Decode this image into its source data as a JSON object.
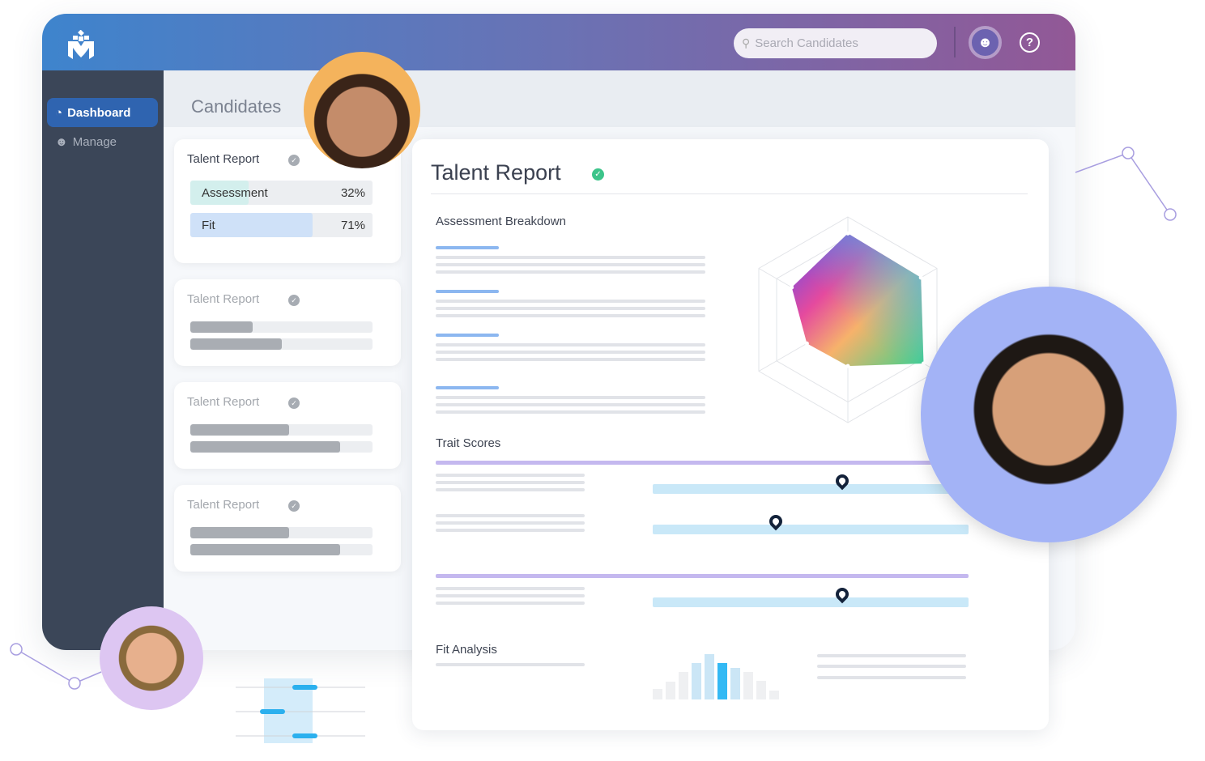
{
  "header": {
    "search_placeholder": "Search Candidates",
    "icons": [
      "logo-icon",
      "search-icon",
      "user-icon",
      "help-icon"
    ],
    "gradient": [
      "#3e84cd",
      "#925896"
    ]
  },
  "sidebar": {
    "items": [
      {
        "label": "Dashboard",
        "icon": "pie-chart-icon",
        "active": true
      },
      {
        "label": "Manage",
        "icon": "users-icon",
        "active": false
      }
    ]
  },
  "page": {
    "title": "Candidates"
  },
  "cards": [
    {
      "title": "Talent Report",
      "bars": [
        {
          "label": "Assessment",
          "value": "32%",
          "fraction": 0.32,
          "color": "#d3efed"
        },
        {
          "label": "Fit",
          "value": "71%",
          "fraction": 0.71,
          "color": "#cfe1f8"
        }
      ]
    },
    {
      "title": "Talent Report",
      "bars": [
        {
          "fraction": 0.34
        },
        {
          "fraction": 0.5
        }
      ]
    },
    {
      "title": "Talent Report",
      "bars": [
        {
          "fraction": 0.54
        },
        {
          "fraction": 0.82
        }
      ]
    },
    {
      "title": "Talent Report",
      "bars": [
        {
          "fraction": 0.54
        },
        {
          "fraction": 0.82
        }
      ]
    }
  ],
  "report": {
    "title": "Talent Report",
    "status": "verified",
    "status_color": "#3cc48a",
    "assessment_breakdown": {
      "title": "Assessment Breakdown",
      "radar_values": [
        0.84,
        0.82,
        0.85,
        0.45,
        0.46,
        0.63
      ]
    },
    "trait_scores": {
      "title": "Trait Scores",
      "markers": [
        0.6,
        0.39,
        0.6
      ]
    },
    "fit_analysis": {
      "title": "Fit Analysis",
      "histogram": [
        13,
        22,
        34,
        45,
        56,
        45,
        39,
        34,
        23,
        11
      ],
      "highlight_index": 5
    }
  }
}
